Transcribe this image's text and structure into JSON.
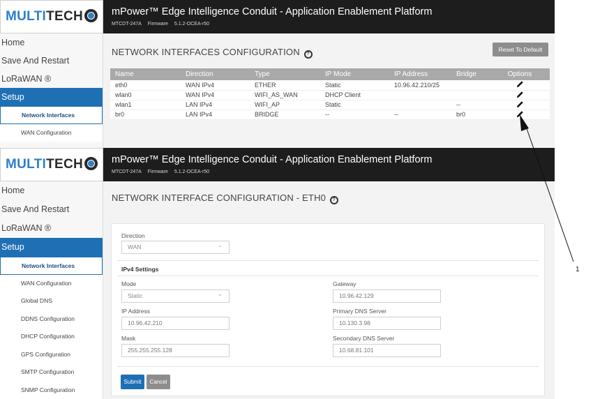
{
  "brand": {
    "logo_multi": "MULTI",
    "logo_tech": "TECH"
  },
  "header": {
    "title": "mPower™ Edge Intelligence Conduit - Application Enablement Platform",
    "model": "MTCDT-247A",
    "firmware_label": "Firmware",
    "firmware_version": "5.1.2-OCEA-r50"
  },
  "sidebar_top": {
    "items": [
      "Home",
      "Save And Restart",
      "LoRaWAN ®",
      "Setup"
    ],
    "subitems": [
      "Network Interfaces",
      "WAN Configuration"
    ]
  },
  "sidebar_bottom": {
    "items": [
      "Home",
      "Save And Restart",
      "LoRaWAN ®",
      "Setup"
    ],
    "subitems": [
      "Network Interfaces",
      "WAN Configuration",
      "Global DNS",
      "DDNS Configuration",
      "DHCP Configuration",
      "GPS Configuration",
      "SMTP Configuration",
      "SNMP Configuration"
    ]
  },
  "interfaces_page": {
    "title": "NETWORK INTERFACES CONFIGURATION",
    "reset_label": "Reset To Default",
    "columns": [
      "Name",
      "Direction",
      "Type",
      "IP Mode",
      "IP Address",
      "Bridge",
      "Options"
    ],
    "rows": [
      [
        "eth0",
        "WAN IPv4",
        "ETHER",
        "Static",
        "10.96.42.210/25",
        ""
      ],
      [
        "wlan0",
        "WAN IPv4",
        "WIFI_AS_WAN",
        "DHCP Client",
        "",
        ""
      ],
      [
        "wlan1",
        "LAN IPv4",
        "WIFI_AP",
        "Static",
        "",
        "--"
      ],
      [
        "br0",
        "LAN IPv4",
        "BRIDGE",
        "--",
        "--",
        "br0"
      ]
    ]
  },
  "interface_form": {
    "title": "NETWORK INTERFACE CONFIGURATION - ETH0",
    "direction_label": "Direction",
    "direction_value": "WAN",
    "ipv4_section": "IPv4 Settings",
    "mode_label": "Mode",
    "mode_value": "Static",
    "ip_label": "IP Address",
    "ip_value": "10.96.42.210",
    "mask_label": "Mask",
    "mask_value": "255.255.255.128",
    "gateway_label": "Gateway",
    "gateway_value": "10.96.42.129",
    "pdns_label": "Primary DNS Server",
    "pdns_value": "10.130.3.98",
    "sdns_label": "Secondary DNS Server",
    "sdns_value": "10.68.81.101",
    "submit_label": "Submit",
    "cancel_label": "Cancel"
  },
  "callout": {
    "number": "1"
  },
  "colors": {
    "accent": "#1f6fb5",
    "topbar": "#1d1d1d",
    "table_header": "#a9a9a9"
  }
}
